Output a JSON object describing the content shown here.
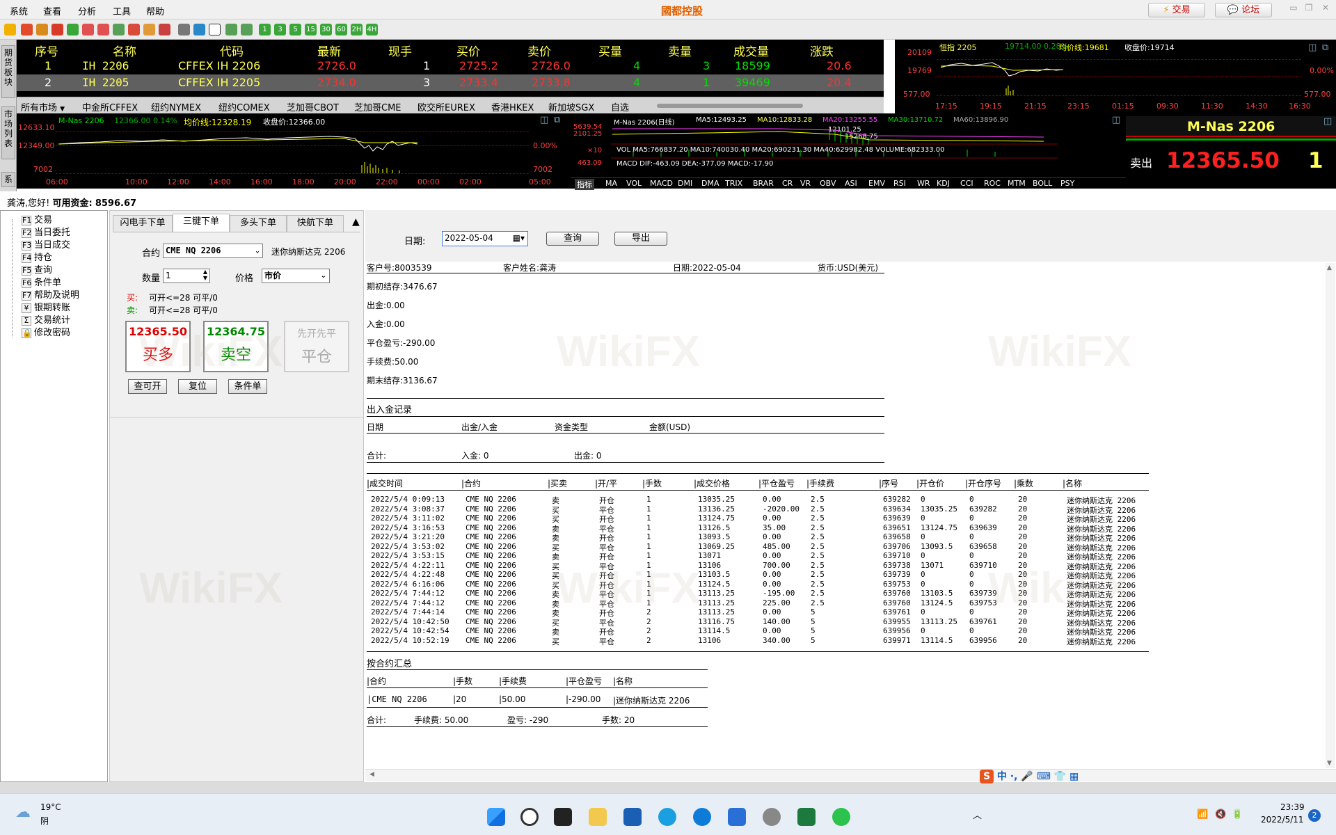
{
  "app": {
    "title": "國都控股"
  },
  "menu": [
    "系统",
    "查看",
    "分析",
    "工具",
    "帮助"
  ],
  "title_buttons": {
    "trade": "交易",
    "forum": "论坛"
  },
  "toolbar_periods": [
    "1",
    "3",
    "5",
    "15",
    "30",
    "60",
    "2H",
    "4H"
  ],
  "side_tabs": [
    "期货板块",
    "市场列表",
    "系"
  ],
  "quote_table": {
    "headers": [
      "序号",
      "名称",
      "代码",
      "最新",
      "现手",
      "买价",
      "卖价",
      "买量",
      "卖量",
      "成交量",
      "涨跌"
    ],
    "rows": [
      [
        "1",
        "IH 2206",
        "CFFEX IH 2206",
        "2726.0",
        "1",
        "2725.2",
        "2726.0",
        "4",
        "3",
        "18599",
        "20.6"
      ],
      [
        "2",
        "IH 2205",
        "CFFEX IH 2205",
        "2734.0",
        "3",
        "2733.4",
        "2733.8",
        "4",
        "1",
        "39469",
        "20.4"
      ]
    ]
  },
  "market_tabs": [
    "所有市场",
    "中金所CFFEX",
    "纽约NYMEX",
    "纽约COMEX",
    "芝加哥CBOT",
    "芝加哥CME",
    "欧交所EUREX",
    "香港HKEX",
    "新加坡SGX",
    "自选"
  ],
  "hang_seng": {
    "title": "恒指 2205",
    "info": "19714.00 0.28%",
    "avg": "均价线:19681",
    "close": "收盘价:19714",
    "y_labels": [
      "20109",
      "19769",
      "577.00"
    ],
    "right_labels": [
      "0.00%",
      "577.00"
    ],
    "times": [
      "17:15",
      "19:15",
      "21:15",
      "23:15",
      "01:15",
      "09:30",
      "11:30",
      "14:30",
      "16:30"
    ]
  },
  "intraday": {
    "title": "M-Nas 2206",
    "info": "12366.00 0.14%",
    "avg": "均价线:12328.19",
    "close": "收盘价:12366.00",
    "y_labels": [
      "12633.10",
      "12349.00",
      "7002"
    ],
    "right_labels": [
      "0.00%",
      "7002"
    ],
    "times": [
      "06:00",
      "10:00",
      "12:00",
      "14:00",
      "16:00",
      "18:00",
      "20:00",
      "22:00",
      "00:00",
      "02:00",
      "05:00"
    ]
  },
  "kline": {
    "title": "M-Nas 2206(日线)",
    "ma5": "MA5:12493.25",
    "ma10": "MA10:12833.28",
    "ma20": "MA20:13255.55",
    "ma30": "MA30:13710.72",
    "ma60": "MA60:13896.90",
    "y_labels": [
      "5639.54",
      "2101.25",
      "×10",
      "463.09"
    ],
    "vol_text": "VOL MA5:766837.20 MA10:740030.40 MA20:690231.30 MA40:629982.48 VOLUME:682333.00",
    "macd_text": "MACD DIF:-463.09 DEA:-377.09 MACD:-17.90",
    "marks": [
      "15268.75",
      "12101.25"
    ],
    "indicators": [
      "指标",
      "MA",
      "VOL",
      "MACD",
      "DMI",
      "DMA",
      "TRIX",
      "BRAR",
      "CR",
      "VR",
      "OBV",
      "ASI",
      "EMV",
      "RSI",
      "WR",
      "KDJ",
      "CCI",
      "ROC",
      "MTM",
      "BOLL",
      "PSY"
    ]
  },
  "big_quote": {
    "name": "M-Nas 2206",
    "label": "卖出",
    "price": "12365.50",
    "qty": "1"
  },
  "greeting": {
    "text": "龚涛,您好!",
    "fund_label": "可用资金:",
    "fund": "8596.67"
  },
  "tree": [
    {
      "key": "F1",
      "label": "交易"
    },
    {
      "key": "F2",
      "label": "当日委托"
    },
    {
      "key": "F3",
      "label": "当日成交"
    },
    {
      "key": "F4",
      "label": "持仓"
    },
    {
      "key": "F5",
      "label": "查询"
    },
    {
      "key": "F6",
      "label": "条件单"
    },
    {
      "key": "F7",
      "label": "帮助及说明"
    },
    {
      "key": "¥",
      "label": "银期转账"
    },
    {
      "key": "Σ",
      "label": "交易统计"
    },
    {
      "key": "🔒",
      "label": "修改密码"
    }
  ],
  "order": {
    "tabs": [
      "闪电手下单",
      "三键下单",
      "多头下单",
      "快航下单"
    ],
    "contract_label": "合约",
    "contract": "CME NQ 2206",
    "contract_name": "迷你纳斯达克 2206",
    "qty_label": "数量",
    "qty": "1",
    "price_label": "价格",
    "price_type": "市价",
    "buy_label": "买:",
    "buy_text": "可开<=28 可平/0",
    "sell_label": "卖:",
    "sell_text": "可开<=28 可平/0",
    "buy_price": "12365.50",
    "buy_action": "买多",
    "sell_price": "12364.75",
    "sell_action": "卖空",
    "close_top": "先开先平",
    "close_action": "平仓",
    "btn_query": "查可开",
    "btn_reset": "复位",
    "btn_cond": "条件单"
  },
  "report": {
    "date_label": "日期:",
    "date_value": "2022-05-04",
    "query_btn": "查询",
    "export_btn": "导出",
    "header": {
      "account": "客户号:8003539",
      "name": "客户姓名:龚涛",
      "date": "日期:2022-05-04",
      "currency": "货币:USD(美元)"
    },
    "summary": [
      "期初结存:3476.67",
      "出金:0.00",
      "入金:0.00",
      "平仓盈亏:-290.00",
      "手续费:50.00",
      "期末结存:3136.67"
    ],
    "cash_title": "出入金记录",
    "cash_headers": [
      "日期",
      "出金/入金",
      "资金类型",
      "金额(USD)"
    ],
    "cash_total": {
      "label": "合计:",
      "in": "入金: 0",
      "out": "出金: 0"
    },
    "trade_headers": [
      "|成交时间",
      "|合约",
      "|买卖",
      "|开/平",
      "|手数",
      "|成交价格",
      "|平仓盈亏",
      "|手续费",
      "|序号",
      "|开仓价",
      "|开仓序号",
      "|乘数",
      "|名称"
    ],
    "trades": [
      [
        "2022/5/4 0:09:13",
        "CME NQ 2206",
        "卖",
        "开仓",
        "1",
        "13035.25",
        "0.00",
        "2.5",
        "639282",
        "0",
        "0",
        "20",
        "迷你纳斯达克 2206"
      ],
      [
        "2022/5/4 3:08:37",
        "CME NQ 2206",
        "买",
        "平仓",
        "1",
        "13136.25",
        "-2020.00",
        "2.5",
        "639634",
        "13035.25",
        "639282",
        "20",
        "迷你纳斯达克 2206"
      ],
      [
        "2022/5/4 3:11:02",
        "CME NQ 2206",
        "买",
        "开仓",
        "1",
        "13124.75",
        "0.00",
        "2.5",
        "639639",
        "0",
        "0",
        "20",
        "迷你纳斯达克 2206"
      ],
      [
        "2022/5/4 3:16:53",
        "CME NQ 2206",
        "卖",
        "平仓",
        "1",
        "13126.5",
        "35.00",
        "2.5",
        "639651",
        "13124.75",
        "639639",
        "20",
        "迷你纳斯达克 2206"
      ],
      [
        "2022/5/4 3:21:20",
        "CME NQ 2206",
        "卖",
        "开仓",
        "1",
        "13093.5",
        "0.00",
        "2.5",
        "639658",
        "0",
        "0",
        "20",
        "迷你纳斯达克 2206"
      ],
      [
        "2022/5/4 3:53:02",
        "CME NQ 2206",
        "买",
        "平仓",
        "1",
        "13069.25",
        "485.00",
        "2.5",
        "639706",
        "13093.5",
        "639658",
        "20",
        "迷你纳斯达克 2206"
      ],
      [
        "2022/5/4 3:53:15",
        "CME NQ 2206",
        "卖",
        "开仓",
        "1",
        "13071",
        "0.00",
        "2.5",
        "639710",
        "0",
        "0",
        "20",
        "迷你纳斯达克 2206"
      ],
      [
        "2022/5/4 4:22:11",
        "CME NQ 2206",
        "买",
        "平仓",
        "1",
        "13106",
        "700.00",
        "2.5",
        "639738",
        "13071",
        "639710",
        "20",
        "迷你纳斯达克 2206"
      ],
      [
        "2022/5/4 4:22:48",
        "CME NQ 2206",
        "买",
        "开仓",
        "1",
        "13103.5",
        "0.00",
        "2.5",
        "639739",
        "0",
        "0",
        "20",
        "迷你纳斯达克 2206"
      ],
      [
        "2022/5/4 6:16:06",
        "CME NQ 2206",
        "买",
        "开仓",
        "1",
        "13124.5",
        "0.00",
        "2.5",
        "639753",
        "0",
        "0",
        "20",
        "迷你纳斯达克 2206"
      ],
      [
        "2022/5/4 7:44:12",
        "CME NQ 2206",
        "卖",
        "平仓",
        "1",
        "13113.25",
        "-195.00",
        "2.5",
        "639760",
        "13103.5",
        "639739",
        "20",
        "迷你纳斯达克 2206"
      ],
      [
        "2022/5/4 7:44:12",
        "CME NQ 2206",
        "卖",
        "平仓",
        "1",
        "13113.25",
        "225.00",
        "2.5",
        "639760",
        "13124.5",
        "639753",
        "20",
        "迷你纳斯达克 2206"
      ],
      [
        "2022/5/4 7:44:14",
        "CME NQ 2206",
        "卖",
        "开仓",
        "2",
        "13113.25",
        "0.00",
        "5",
        "639761",
        "0",
        "0",
        "20",
        "迷你纳斯达克 2206"
      ],
      [
        "2022/5/4 10:42:50",
        "CME NQ 2206",
        "买",
        "平仓",
        "2",
        "13116.75",
        "140.00",
        "5",
        "639955",
        "13113.25",
        "639761",
        "20",
        "迷你纳斯达克 2206"
      ],
      [
        "2022/5/4 10:42:54",
        "CME NQ 2206",
        "卖",
        "开仓",
        "2",
        "13114.5",
        "0.00",
        "5",
        "639956",
        "0",
        "0",
        "20",
        "迷你纳斯达克 2206"
      ],
      [
        "2022/5/4 10:52:19",
        "CME NQ 2206",
        "买",
        "平仓",
        "2",
        "13106",
        "340.00",
        "5",
        "639971",
        "13114.5",
        "639956",
        "20",
        "迷你纳斯达克 2206"
      ]
    ],
    "by_contract_title": "按合约汇总",
    "bc_headers": [
      "|合约",
      "|手数",
      "|手续费",
      "|平仓盈亏",
      "|名称"
    ],
    "bc_row": [
      "|CME NQ 2206",
      "|20",
      "|50.00",
      "|-290.00",
      "|迷你纳斯达克 2206"
    ],
    "bc_total": {
      "label": "合计:",
      "fee": "手续费: 50.00",
      "pnl": "盈亏: -290",
      "lots": "手数: 20"
    }
  },
  "taskbar": {
    "weather_temp": "19°C",
    "weather_desc": "阴",
    "time": "23:39",
    "date": "2022/5/11",
    "ime": "中",
    "badge": "2"
  },
  "watermark": "WikiFX",
  "colors": {
    "up": "#ff3030",
    "down": "#00cc00",
    "price_red": "#ff2020",
    "yellow": "#ffff54"
  }
}
